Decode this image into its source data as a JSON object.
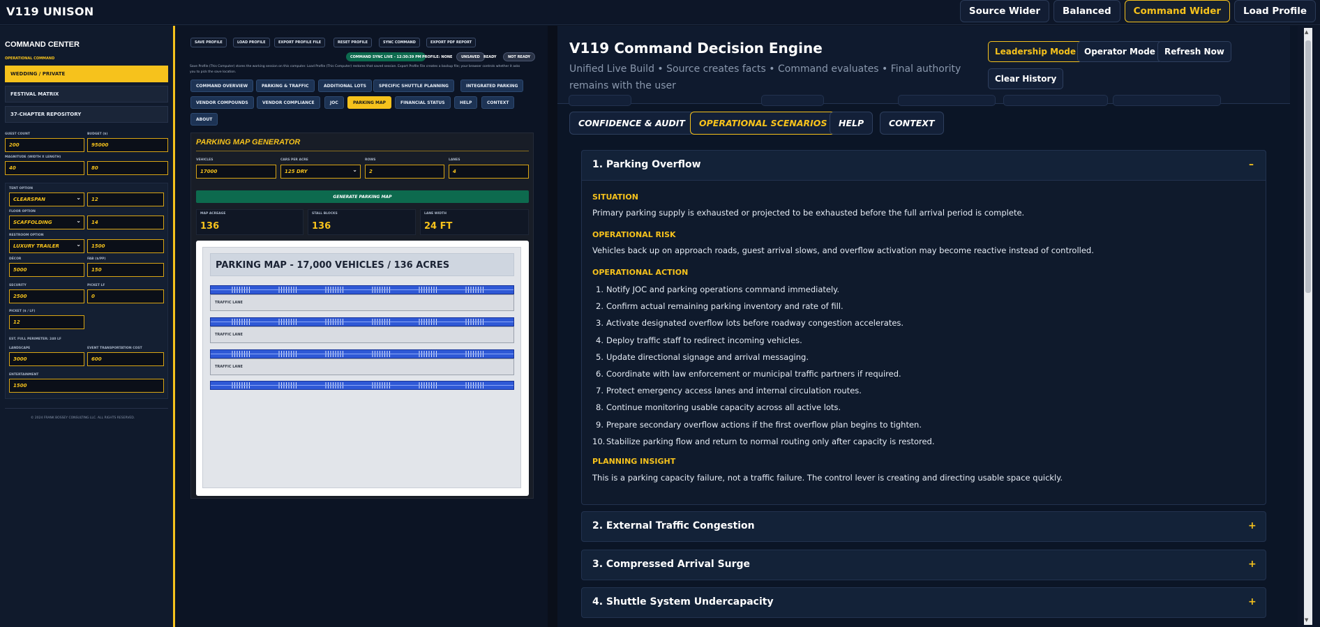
{
  "app": {
    "title": "V119 UNISON"
  },
  "topbar": {
    "buttons": [
      "Source Wider",
      "Balanced",
      "Command Wider",
      "Load Profile"
    ],
    "active": "Command Wider"
  },
  "sidebar": {
    "title": "COMMAND CENTER",
    "subtitle": "OPERATIONAL COMMAND",
    "nav": [
      "WEDDING / PRIVATE",
      "FESTIVAL MATRIX",
      "37-CHAPTER REPOSITORY"
    ],
    "fields": {
      "guest_count": {
        "label": "GUEST COUNT",
        "value": "200"
      },
      "budget": {
        "label": "BUDGET ($)",
        "value": "95000"
      },
      "magnitude": {
        "label": "MAGNITUDE (WIDTH X LENGTH)",
        "width": "40",
        "length": "80"
      },
      "tent": {
        "label": "TENT OPTION",
        "value": "CLEARSPAN",
        "qty": "12"
      },
      "floor": {
        "label": "FLOOR OPTION",
        "value": "SCAFFOLDING",
        "qty": "14"
      },
      "restroom": {
        "label": "RESTROOM OPTION",
        "value": "LUXURY TRAILER",
        "qty": "1500"
      },
      "decor": {
        "label": "DÉCOR",
        "value": "5000"
      },
      "fab": {
        "label": "FAB ($/PP)",
        "value": "150"
      },
      "security": {
        "label": "SECURITY",
        "value": "2500"
      },
      "picket_lf": {
        "label": "PICKET LF",
        "value": "0"
      },
      "picket_rate": {
        "label": "PICKET ($ / LF)",
        "value": "12"
      },
      "perimeter": "EST. FULL PERIMETER: 240 LF",
      "landscape": {
        "label": "LANDSCAPE",
        "value": "3000"
      },
      "transport": {
        "label": "EVENT TRANSPORTATION COST",
        "value": "600"
      },
      "entertainment": {
        "label": "ENTERTAINMENT",
        "value": "1500"
      }
    },
    "copyright": "© 2024 FRANK BOSSEY CONSULTING LLC. ALL RIGHTS RESERVED."
  },
  "mid": {
    "toolbar": [
      "SAVE PROFILE",
      "LOAD PROFILE",
      "EXPORT PROFILE FILE",
      "RESET PROFILE",
      "SYNC COMMAND",
      "EXPORT PDF REPORT"
    ],
    "sync_status": "COMMAND SYNC LIVE - 12:30:39 PM",
    "profile": "PROFILE: NONE",
    "unsaved": "UNSAVED",
    "ready": "READY",
    "not_ready": "NOT READY",
    "info": "Save Profile (This Computer) stores the working session on this computer. Load Profile (This Computer) restores that saved session. Export Profile File creates a backup file; your browser controls whether it asks you to pick the save location.",
    "tabs": [
      "COMMAND OVERVIEW",
      "PARKING & TRAFFIC",
      "ADDITIONAL LOTS",
      "SPECIFIC SHUTTLE PLANNING",
      "INTEGRATED PARKING",
      "VENDOR COMPOUNDS",
      "VENDOR COMPLIANCE",
      "JOC",
      "PARKING MAP",
      "FINANCIAL STATUS",
      "HELP",
      "CONTEXT",
      "ABOUT"
    ],
    "active_tab": "PARKING MAP",
    "generator": {
      "title": "PARKING MAP GENERATOR",
      "vehicles": {
        "label": "VEHICLES",
        "value": "17000"
      },
      "cars_per_acre": {
        "label": "CARS PER ACRE",
        "value": "125 DRY"
      },
      "rows": {
        "label": "ROWS",
        "value": "2"
      },
      "lanes": {
        "label": "LANES",
        "value": "4"
      },
      "button": "GENERATE PARKING MAP",
      "stats": [
        {
          "label": "MAP ACREAGE",
          "value": "136"
        },
        {
          "label": "STALL BLOCKS",
          "value": "136"
        },
        {
          "label": "LANE WIDTH",
          "value": "24 FT"
        }
      ],
      "map_title": "PARKING MAP - 17,000 VEHICLES / 136 ACRES",
      "lane_label": "TRAFFIC LANE"
    }
  },
  "engine": {
    "title": "V119 Command Decision Engine",
    "subtitle": "Unified Live Build • Source creates facts • Command evaluates • Final authority remains with the user",
    "buttons": [
      "Leadership Mode",
      "Operator Mode",
      "Refresh Now",
      "Clear History"
    ],
    "active_button": "Leadership Mode",
    "tabs": [
      "CONFIDENCE & AUDIT",
      "OPERATIONAL SCENARIOS",
      "HELP",
      "CONTEXT"
    ],
    "active_tab": "OPERATIONAL SCENARIOS",
    "scenario_open": {
      "title": "1. Parking Overflow",
      "sign": "–",
      "situation_h": "SITUATION",
      "situation": "Primary parking supply is exhausted or projected to be exhausted before the full arrival period is complete.",
      "risk_h": "OPERATIONAL RISK",
      "risk": "Vehicles back up on approach roads, guest arrival slows, and overflow activation may become reactive instead of controlled.",
      "action_h": "OPERATIONAL ACTION",
      "actions": [
        "Notify JOC and parking operations command immediately.",
        "Confirm actual remaining parking inventory and rate of fill.",
        "Activate designated overflow lots before roadway congestion accelerates.",
        "Deploy traffic staff to redirect incoming vehicles.",
        "Update directional signage and arrival messaging.",
        "Coordinate with law enforcement or municipal traffic partners if required.",
        "Protect emergency access lanes and internal circulation routes.",
        "Continue monitoring usable capacity across all active lots.",
        "Prepare secondary overflow actions if the first overflow plan begins to tighten.",
        "Stabilize parking flow and return to normal routing only after capacity is restored."
      ],
      "insight_h": "PLANNING INSIGHT",
      "insight": "This is a parking capacity failure, not a traffic failure. The control lever is creating and directing usable space quickly."
    },
    "scenarios_closed": [
      "2. External Traffic Congestion",
      "3. Compressed Arrival Surge",
      "4. Shuttle System Undercapacity"
    ],
    "closed_sign": "+"
  }
}
